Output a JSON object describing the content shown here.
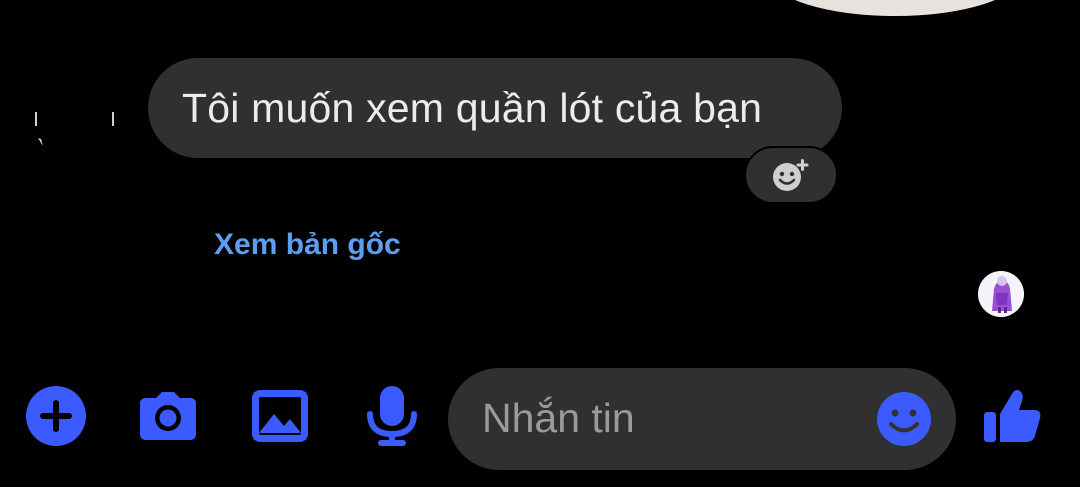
{
  "colors": {
    "accent": "#3b5bff",
    "link": "#5e9ef2",
    "bubble": "#303030",
    "background": "#000000"
  },
  "message": {
    "text": "Tôi muốn xem quần lót của bạn"
  },
  "translation": {
    "see_original_label": "Xem bản gốc"
  },
  "composer": {
    "placeholder": "Nhắn tin",
    "icons": [
      "plus-icon",
      "camera-icon",
      "image-icon",
      "microphone-icon",
      "emoji-icon",
      "thumbs-up-icon"
    ]
  }
}
